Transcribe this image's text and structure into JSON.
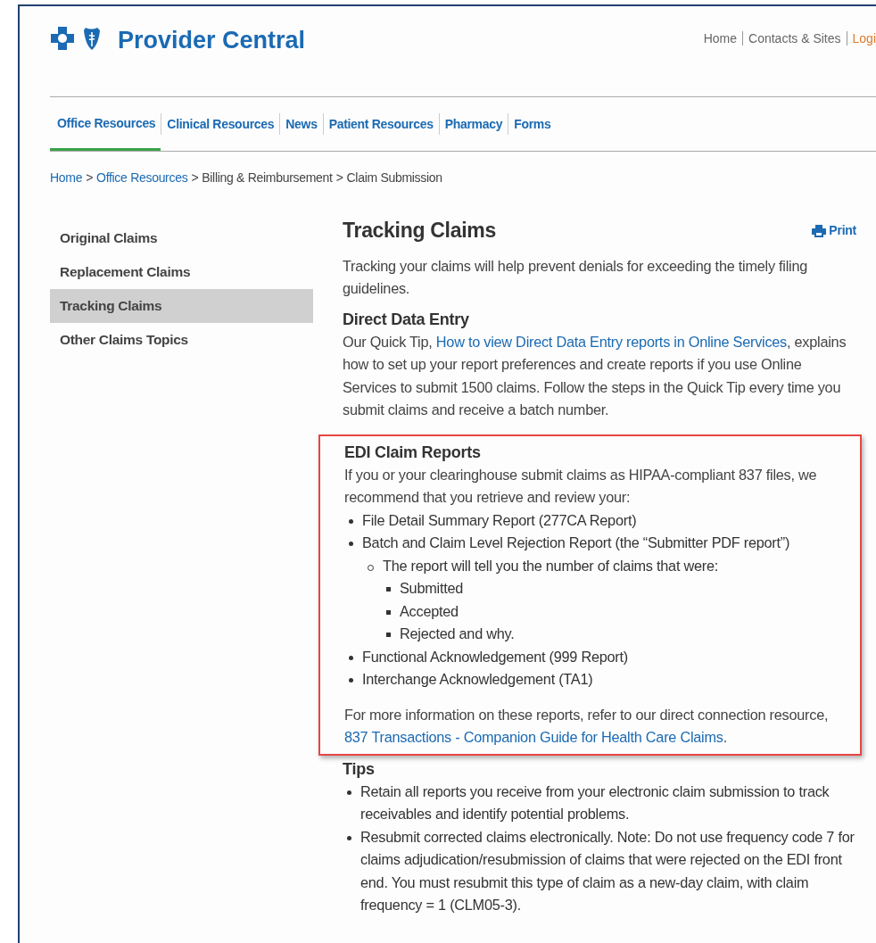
{
  "header": {
    "title": "Provider Central",
    "utility_links": [
      {
        "label": "Home",
        "kind": "plain"
      },
      {
        "label": "Contacts & Sites",
        "kind": "plain"
      },
      {
        "label": "Logi",
        "kind": "accent"
      }
    ]
  },
  "nav": {
    "tabs": [
      {
        "label": "Office Resources",
        "selected": true
      },
      {
        "label": "Clinical Resources",
        "selected": false
      },
      {
        "label": "News",
        "selected": false
      },
      {
        "label": "Patient Resources",
        "selected": false
      },
      {
        "label": "Pharmacy",
        "selected": false
      },
      {
        "label": "Forms",
        "selected": false
      }
    ]
  },
  "breadcrumb": [
    {
      "label": "Home",
      "link": true
    },
    {
      "separator": ">",
      "label": "Office Resources",
      "link": true
    },
    {
      "separator": ">",
      "label": "Billing & Reimbursement",
      "link": false
    },
    {
      "separator": ">",
      "label": "Claim Submission",
      "link": false
    }
  ],
  "sidebar": {
    "items": [
      {
        "label": "Original Claims",
        "selected": false
      },
      {
        "label": "Replacement Claims",
        "selected": false
      },
      {
        "label": "Tracking Claims",
        "selected": true
      },
      {
        "label": "Other Claims Topics",
        "selected": false
      }
    ]
  },
  "article": {
    "title": "Tracking Claims",
    "print": "Print",
    "intro": "Tracking your claims will help prevent denials for exceeding the timely filing guidelines.",
    "sections": [
      {
        "heading": "Direct Data Entry",
        "highlighted": false,
        "paragraph": {
          "before": "Our Quick Tip, ",
          "link": "How to view Direct Data Entry reports in Online Services",
          "after": ", explains how to set up your report preferences and create reports if you use Online Services to submit 1500 claims. Follow the steps in the Quick Tip every time you submit claims and receive a batch number."
        }
      },
      {
        "heading": "EDI Claim Reports",
        "highlighted": true,
        "text": "If you or your clearinghouse submit claims as HIPAA-compliant 837 files, we recommend that you retrieve and review your:",
        "list": [
          {
            "label": "File Detail Summary Report (277CA Report)"
          },
          {
            "label": "Batch and Claim Level Rejection Report (the “Submitter PDF report”)",
            "children": [
              {
                "label": "The report will tell you the number of claims that were:",
                "children": [
                  {
                    "label": "Submitted"
                  },
                  {
                    "label": "Accepted"
                  },
                  {
                    "label": "Rejected and why."
                  }
                ]
              }
            ]
          },
          {
            "label": "Functional Acknowledgement (999 Report)"
          },
          {
            "label": "Interchange Acknowledgement (TA1)"
          }
        ],
        "footer": {
          "before": "For more information on these reports, refer to our direct connection resource, ",
          "link": "837 Transactions - Companion Guide for Health Care Claims",
          "after": "."
        }
      },
      {
        "heading": "Tips",
        "highlighted": false,
        "list": [
          {
            "label": "Retain all reports you receive from your electronic claim submission to track receivables and identify potential problems."
          },
          {
            "label": "Resubmit corrected claims electronically. Note: Do not use frequency code 7 for claims adjudication/resubmission of claims that were rejected on the EDI front end. You must resubmit this type of claim as a new-day claim, with claim frequency = 1 (CLM05-3)."
          }
        ]
      }
    ]
  }
}
